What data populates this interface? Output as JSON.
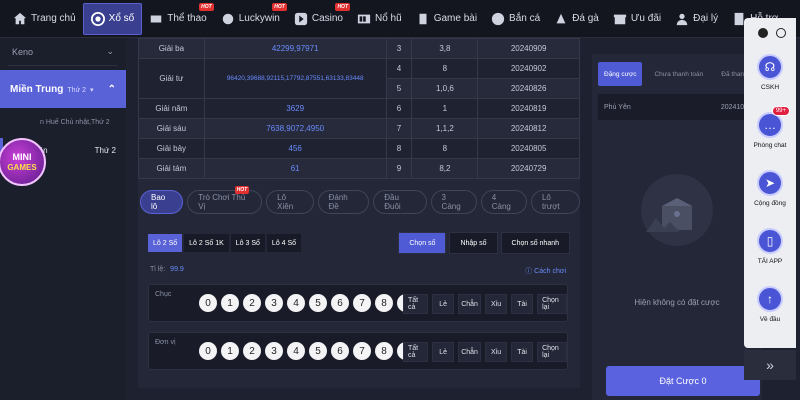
{
  "nav": {
    "items": [
      {
        "label": "Trang chủ",
        "icon": "home-icon",
        "hot": false,
        "active": false
      },
      {
        "label": "Xổ số",
        "icon": "lottery-icon",
        "hot": false,
        "active": true
      },
      {
        "label": "Thể thao",
        "icon": "sports-icon",
        "hot": true,
        "active": false
      },
      {
        "label": "Luckywin",
        "icon": "luckywin-icon",
        "hot": true,
        "active": false
      },
      {
        "label": "Casino",
        "icon": "casino-icon",
        "hot": true,
        "active": false
      },
      {
        "label": "Nổ hũ",
        "icon": "slot-icon",
        "hot": false,
        "active": false
      },
      {
        "label": "Game bài",
        "icon": "cards-icon",
        "hot": false,
        "active": false
      },
      {
        "label": "Bắn cá",
        "icon": "fish-icon",
        "hot": false,
        "active": false
      },
      {
        "label": "Đá gà",
        "icon": "rooster-icon",
        "hot": false,
        "active": false
      },
      {
        "label": "Ưu đãi",
        "icon": "promo-icon",
        "hot": false,
        "active": false
      },
      {
        "label": "Đại lý",
        "icon": "agent-icon",
        "hot": false,
        "active": false
      },
      {
        "label": "Hỗ trợ",
        "icon": "support-icon",
        "hot": false,
        "active": false
      }
    ],
    "hot_label": "HOT"
  },
  "left": {
    "keno": "Keno",
    "region": "Miền Trung",
    "region_sub": "Thứ 2",
    "sub1": "n Huế Chủ nhật,Thứ 2",
    "city": "Phú Yên",
    "city_day": "Thứ 2",
    "minigames_line1": "MINI",
    "minigames_line2": "GAMES"
  },
  "results": [
    {
      "prize": "Giải ba",
      "numbers": "42299,97971",
      "no": "3",
      "val": "3,8",
      "date": "20240909"
    },
    {
      "prize": "Giải tư",
      "numbers": "96420,39688,92115,17792,87551,63133,83448",
      "no": "4",
      "val": "8",
      "date": "20240902"
    },
    {
      "prize": "",
      "numbers": "",
      "no": "5",
      "val": "1,0,6",
      "date": "20240826"
    },
    {
      "prize": "Giải năm",
      "numbers": "3629",
      "no": "6",
      "val": "1",
      "date": "20240819"
    },
    {
      "prize": "Giải sáu",
      "numbers": "7638,9072,4950",
      "no": "7",
      "val": "1,1,2",
      "date": "20240812"
    },
    {
      "prize": "Giải bảy",
      "numbers": "456",
      "no": "8",
      "val": "8",
      "date": "20240805"
    },
    {
      "prize": "Giải tám",
      "numbers": "61",
      "no": "9",
      "val": "8,2",
      "date": "20240729"
    }
  ],
  "filters": [
    "Bao lô",
    "Trò Chơi Thú Vị",
    "Lô Xiên",
    "Đánh Đề",
    "Đầu Đuôi",
    "3 Càng",
    "4 Càng",
    "Lô trượt"
  ],
  "subtabs": [
    "Lô 2 Số",
    "Lô 2 Số 1K",
    "Lô 3 Số",
    "Lô 4 Số"
  ],
  "modes": [
    "Chọn số",
    "Nhập số",
    "Chọn số nhanh"
  ],
  "rate": {
    "label": "Tỉ lệ:",
    "value": "99.9"
  },
  "help": "Cách chơi",
  "rows": [
    {
      "label": "Chục",
      "digits": [
        "0",
        "1",
        "2",
        "3",
        "4",
        "5",
        "6",
        "7",
        "8",
        "9"
      ]
    },
    {
      "label": "Đơn vị",
      "digits": [
        "0",
        "1",
        "2",
        "3",
        "4",
        "5",
        "6",
        "7",
        "8",
        "9"
      ]
    }
  ],
  "quick": [
    "Tất cả",
    "Lẻ",
    "Chẵn",
    "Xỉu",
    "Tài",
    "Chọn lại"
  ],
  "bet": {
    "tabs": [
      "Đặng cược",
      "Chưa thanh toán",
      "Đã thanh toán"
    ],
    "city": "Phú Yên",
    "code": "20241007",
    "empty": "Hiện không có đặt cược",
    "place": "Đặt Cược 0"
  },
  "rail": [
    {
      "label": "CSKH",
      "icon": "headset-icon"
    },
    {
      "label": "Phòng chat",
      "icon": "chat-icon",
      "badge": "99+"
    },
    {
      "label": "Cộng đồng",
      "icon": "telegram-icon"
    },
    {
      "label": "TẢI APP",
      "icon": "phone-icon"
    },
    {
      "label": "Về đầu",
      "icon": "arrow-up-icon"
    }
  ],
  "rail_more": "»"
}
